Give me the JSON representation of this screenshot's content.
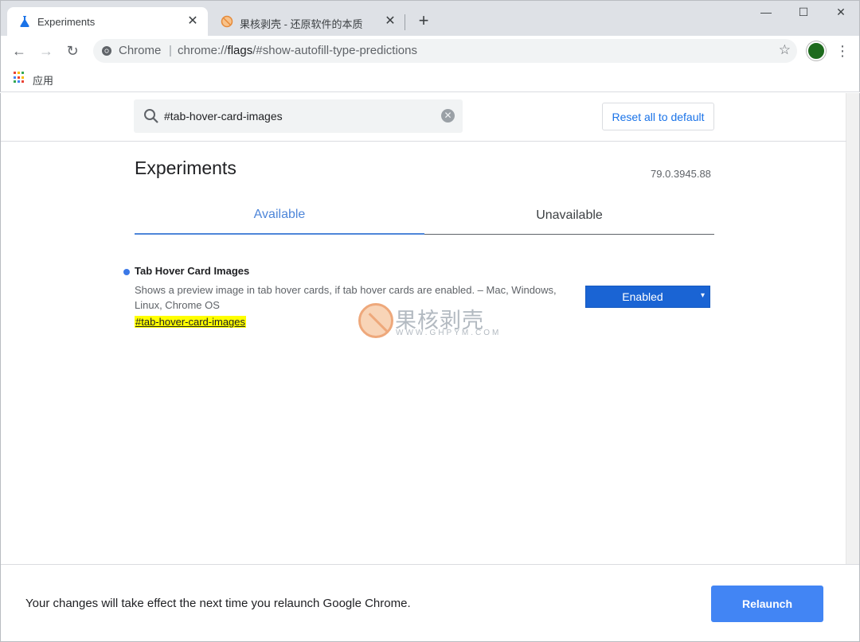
{
  "tabs": [
    {
      "title": "Experiments",
      "icon": "flask-icon"
    },
    {
      "title": "果核剥壳 - 还原软件的本质",
      "icon": "guohe-favicon-icon"
    }
  ],
  "tab_close_glyph": "✕",
  "new_tab_glyph": "+",
  "window_controls": {
    "minimize": "—",
    "maximize": "☐",
    "close": "✕"
  },
  "toolbar": {
    "back_glyph": "←",
    "forward_glyph": "→",
    "reload_glyph": "↻",
    "scheme_label": "Chrome",
    "scheme_separator": "|",
    "url_prefix": "chrome://",
    "url_host": "flags",
    "url_rest": "/#show-autofill-type-predictions",
    "star_glyph": "☆",
    "menu_glyph": "⋮"
  },
  "bookmarks": {
    "apps_label": "应用"
  },
  "search": {
    "value": "#tab-hover-card-images",
    "clear_glyph": "✕"
  },
  "reset_button": "Reset all to default",
  "page_title": "Experiments",
  "version": "79.0.3945.88",
  "content_tabs": {
    "available": "Available",
    "unavailable": "Unavailable"
  },
  "flag": {
    "name": "Tab Hover Card Images",
    "description": "Shows a preview image in tab hover cards, if tab hover cards are enabled. – Mac, Windows, Linux, Chrome OS",
    "link": "#tab-hover-card-images",
    "selected": "Enabled",
    "arrow": "▾"
  },
  "watermark": {
    "text": "果核剥壳",
    "sub": "WWW.GHPYM.COM"
  },
  "footer": {
    "message": "Your changes will take effect the next time you relaunch Google Chrome.",
    "relaunch": "Relaunch"
  },
  "colors": {
    "accent": "#4285f4",
    "select_bg": "#1a64d4",
    "highlight": "#ffff00",
    "tab_active": "#4e86d9"
  }
}
